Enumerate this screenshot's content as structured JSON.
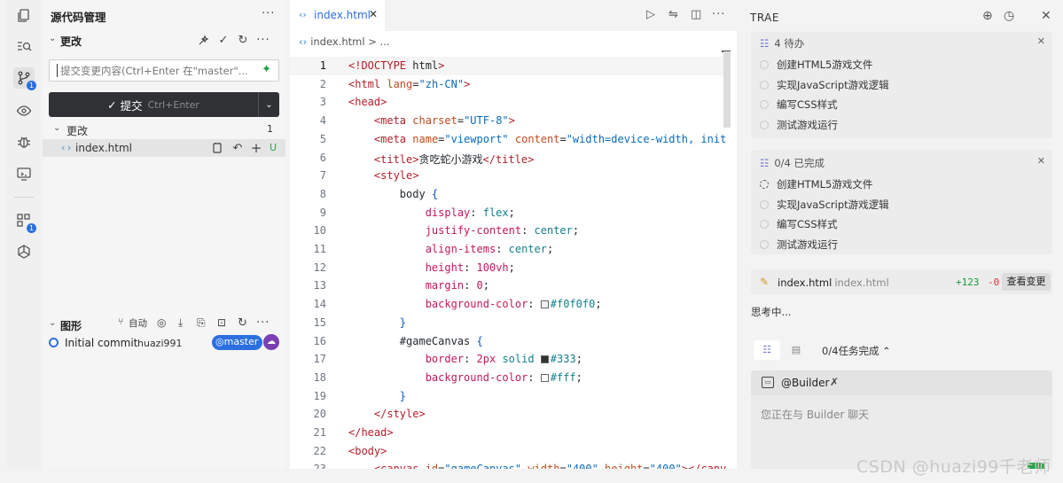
{
  "scm": {
    "title": "源代码管理",
    "changes_section_label": "更改",
    "commit_input_placeholder": "提交变更内容(Ctrl+Enter 在\"master\"...",
    "commit_button_label": "提交",
    "commit_button_shortcut": "Ctrl+Enter",
    "changes_group_label": "更改",
    "changes_count": "1",
    "file_name": "index.html",
    "file_status": "U",
    "graph_section_label": "图形",
    "graph_auto_label": "自动",
    "commit_message": "Initial commit",
    "commit_author": "huazi991",
    "branch_label": "master"
  },
  "editor": {
    "tab_label": "index.html",
    "breadcrumb_file": "index.html",
    "breadcrumb_rest": "> ...",
    "current_line": 1,
    "lines": [
      [
        {
          "c": "tag",
          "t": "<!DOCTYPE "
        },
        {
          "c": "plain",
          "t": "html"
        },
        {
          "c": "tag",
          "t": ">"
        }
      ],
      [
        {
          "c": "tag",
          "t": "<html "
        },
        {
          "c": "attr",
          "t": "lang"
        },
        {
          "c": "plain",
          "t": "="
        },
        {
          "c": "str",
          "t": "\"zh-CN\""
        },
        {
          "c": "tag",
          "t": ">"
        }
      ],
      [
        {
          "c": "tag",
          "t": "<head>"
        }
      ],
      [
        {
          "c": "plain",
          "t": "    "
        },
        {
          "c": "tag",
          "t": "<meta "
        },
        {
          "c": "attr",
          "t": "charset"
        },
        {
          "c": "plain",
          "t": "="
        },
        {
          "c": "str",
          "t": "\"UTF-8\""
        },
        {
          "c": "tag",
          "t": ">"
        }
      ],
      [
        {
          "c": "plain",
          "t": "    "
        },
        {
          "c": "tag",
          "t": "<meta "
        },
        {
          "c": "attr",
          "t": "name"
        },
        {
          "c": "plain",
          "t": "="
        },
        {
          "c": "str",
          "t": "\"viewport\""
        },
        {
          "c": "plain",
          "t": " "
        },
        {
          "c": "attr",
          "t": "content"
        },
        {
          "c": "plain",
          "t": "="
        },
        {
          "c": "str",
          "t": "\"width=device-width, init"
        }
      ],
      [
        {
          "c": "plain",
          "t": "    "
        },
        {
          "c": "tag",
          "t": "<title>"
        },
        {
          "c": "plain",
          "t": "贪吃蛇小游戏"
        },
        {
          "c": "tag",
          "t": "</title>"
        }
      ],
      [
        {
          "c": "plain",
          "t": "    "
        },
        {
          "c": "tag",
          "t": "<style>"
        }
      ],
      [
        {
          "c": "plain",
          "t": "        body "
        },
        {
          "c": "brace",
          "t": "{"
        }
      ],
      [
        {
          "c": "plain",
          "t": "            "
        },
        {
          "c": "prop",
          "t": "display"
        },
        {
          "c": "plain",
          "t": ": "
        },
        {
          "c": "val",
          "t": "flex"
        },
        {
          "c": "plain",
          "t": ";"
        }
      ],
      [
        {
          "c": "plain",
          "t": "            "
        },
        {
          "c": "prop",
          "t": "justify-content"
        },
        {
          "c": "plain",
          "t": ": "
        },
        {
          "c": "val",
          "t": "center"
        },
        {
          "c": "plain",
          "t": ";"
        }
      ],
      [
        {
          "c": "plain",
          "t": "            "
        },
        {
          "c": "prop",
          "t": "align-items"
        },
        {
          "c": "plain",
          "t": ": "
        },
        {
          "c": "val",
          "t": "center"
        },
        {
          "c": "plain",
          "t": ";"
        }
      ],
      [
        {
          "c": "plain",
          "t": "            "
        },
        {
          "c": "prop",
          "t": "height"
        },
        {
          "c": "plain",
          "t": ": "
        },
        {
          "c": "num",
          "t": "100vh"
        },
        {
          "c": "plain",
          "t": ";"
        }
      ],
      [
        {
          "c": "plain",
          "t": "            "
        },
        {
          "c": "prop",
          "t": "margin"
        },
        {
          "c": "plain",
          "t": ": "
        },
        {
          "c": "num",
          "t": "0"
        },
        {
          "c": "plain",
          "t": ";"
        }
      ],
      [
        {
          "c": "plain",
          "t": "            "
        },
        {
          "c": "prop",
          "t": "background-color"
        },
        {
          "c": "plain",
          "t": ": "
        },
        {
          "c": "swatch",
          "t": "#f0f0f0"
        },
        {
          "c": "val",
          "t": "#f0f0f0"
        },
        {
          "c": "plain",
          "t": ";"
        }
      ],
      [
        {
          "c": "plain",
          "t": "        "
        },
        {
          "c": "brace",
          "t": "}"
        }
      ],
      [
        {
          "c": "plain",
          "t": "        #gameCanvas "
        },
        {
          "c": "brace",
          "t": "{"
        }
      ],
      [
        {
          "c": "plain",
          "t": "            "
        },
        {
          "c": "prop",
          "t": "border"
        },
        {
          "c": "plain",
          "t": ": "
        },
        {
          "c": "num",
          "t": "2px"
        },
        {
          "c": "plain",
          "t": " "
        },
        {
          "c": "val",
          "t": "solid"
        },
        {
          "c": "plain",
          "t": " "
        },
        {
          "c": "swatch",
          "t": "#333"
        },
        {
          "c": "val",
          "t": "#333"
        },
        {
          "c": "plain",
          "t": ";"
        }
      ],
      [
        {
          "c": "plain",
          "t": "            "
        },
        {
          "c": "prop",
          "t": "background-color"
        },
        {
          "c": "plain",
          "t": ": "
        },
        {
          "c": "swatch",
          "t": "#fff"
        },
        {
          "c": "val",
          "t": "#fff"
        },
        {
          "c": "plain",
          "t": ";"
        }
      ],
      [
        {
          "c": "plain",
          "t": "        "
        },
        {
          "c": "brace",
          "t": "}"
        }
      ],
      [
        {
          "c": "plain",
          "t": "    "
        },
        {
          "c": "tag",
          "t": "</style>"
        }
      ],
      [
        {
          "c": "tag",
          "t": "</head>"
        }
      ],
      [
        {
          "c": "tag",
          "t": "<body>"
        }
      ],
      [
        {
          "c": "plain",
          "t": "    "
        },
        {
          "c": "tag",
          "t": "<canvas "
        },
        {
          "c": "attr",
          "t": "id"
        },
        {
          "c": "plain",
          "t": "="
        },
        {
          "c": "str",
          "t": "\"gameCanvas\""
        },
        {
          "c": "plain",
          "t": " "
        },
        {
          "c": "attr",
          "t": "width"
        },
        {
          "c": "plain",
          "t": "="
        },
        {
          "c": "str",
          "t": "\"400\""
        },
        {
          "c": "plain",
          "t": " "
        },
        {
          "c": "attr",
          "t": "height"
        },
        {
          "c": "plain",
          "t": "="
        },
        {
          "c": "str",
          "t": "\"400\""
        },
        {
          "c": "tag",
          "t": "></canv"
        }
      ]
    ]
  },
  "trae": {
    "title": "TRAE",
    "todo_card": {
      "header": "4 待办",
      "tasks": [
        "创建HTML5游戏文件",
        "实现JavaScript游戏逻辑",
        "编写CSS样式",
        "测试游戏运行"
      ]
    },
    "done_card": {
      "header": "0/4 已完成",
      "tasks": [
        "创建HTML5游戏文件",
        "实现JavaScript游戏逻辑",
        "编写CSS样式",
        "测试游戏运行"
      ]
    },
    "file_card": {
      "name": "index.html",
      "path": "index.html",
      "additions": "+123",
      "deletions": "-0",
      "view_button": "查看变更"
    },
    "thinking": "思考中...",
    "task_progress": "0/4任务完成",
    "chat": {
      "agent": "@Builder",
      "placeholder": "您正在与 Builder 聊天"
    }
  },
  "watermark": "CSDN @huazi99千老师",
  "colors": {
    "accent_blue": "#2c6fe0",
    "commit_button": "#2f3134",
    "added_green": "#1d9a3a",
    "deleted_red": "#dd3333"
  }
}
